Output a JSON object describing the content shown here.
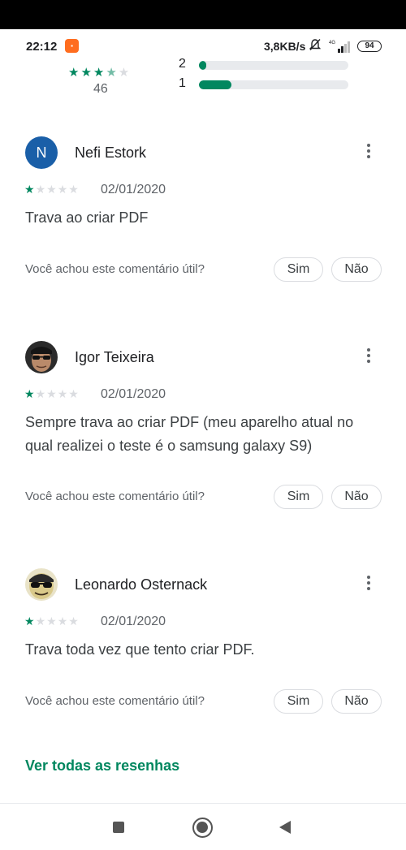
{
  "status_bar": {
    "time": "22:12",
    "network_speed": "3,8KB/s",
    "signal_label": "4G",
    "battery": "94"
  },
  "rating_summary": {
    "average_stars": 3.5,
    "stars_text_on": "★★★",
    "stars_text_half": "★",
    "stars_text_off": "★",
    "count": "46",
    "bars": [
      {
        "label": "2",
        "fraction": 0.05
      },
      {
        "label": "1",
        "fraction": 0.22
      }
    ]
  },
  "reviews": [
    {
      "author": "Nefi Estork",
      "avatar_letter": "N",
      "avatar_color": "#1a5fa8",
      "rating": 1,
      "date": "02/01/2020",
      "text": "Trava ao criar PDF",
      "helpful_prompt": "Você achou este comentário útil?",
      "yes_label": "Sim",
      "no_label": "Não"
    },
    {
      "author": "Igor Teixeira",
      "avatar_letter": "",
      "rating": 1,
      "date": "02/01/2020",
      "text": "Sempre trava ao criar PDF (meu aparelho atual no qual realizei o teste é o samsung galaxy S9)",
      "helpful_prompt": "Você achou este comentário útil?",
      "yes_label": "Sim",
      "no_label": "Não"
    },
    {
      "author": "Leonardo Osternack",
      "avatar_letter": "",
      "rating": 1,
      "date": "02/01/2020",
      "text": "Trava toda vez que tento criar PDF.",
      "helpful_prompt": "Você achou este comentário útil?",
      "yes_label": "Sim",
      "no_label": "Não"
    }
  ],
  "see_all_label": "Ver todas as resenhas",
  "colors": {
    "accent": "#01875f",
    "star_off": "#dadce0"
  }
}
